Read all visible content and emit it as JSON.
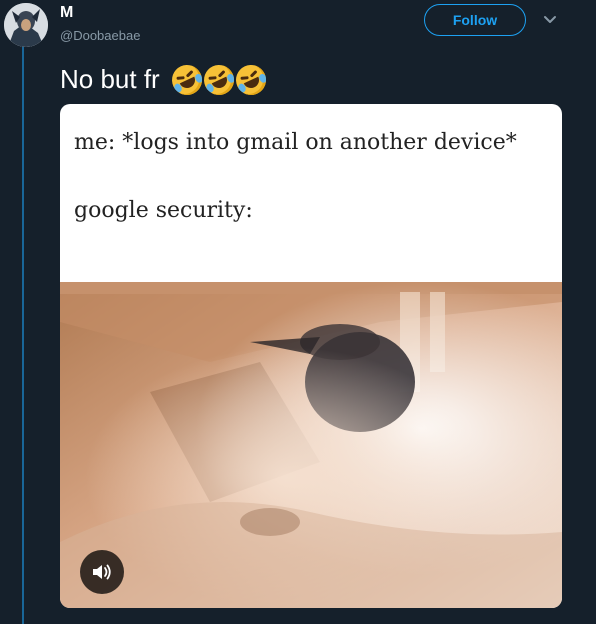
{
  "user": {
    "display_name": "M",
    "handle": "@Doobaebae",
    "avatar_icon": "profile-avatar"
  },
  "actions": {
    "follow_label": "Follow",
    "menu_icon": "chevron-down-icon"
  },
  "tweet": {
    "text": "No but fr",
    "emojis": [
      "rolling-on-floor-laughing",
      "rolling-on-floor-laughing",
      "rolling-on-floor-laughing"
    ]
  },
  "media": {
    "caption_line1": "me: *logs into gmail on another device*",
    "caption_line2": "google security:",
    "volume_icon": "speaker-icon"
  },
  "colors": {
    "background": "#15202b",
    "accent": "#1da1f2",
    "secondary_text": "#8899a6"
  }
}
